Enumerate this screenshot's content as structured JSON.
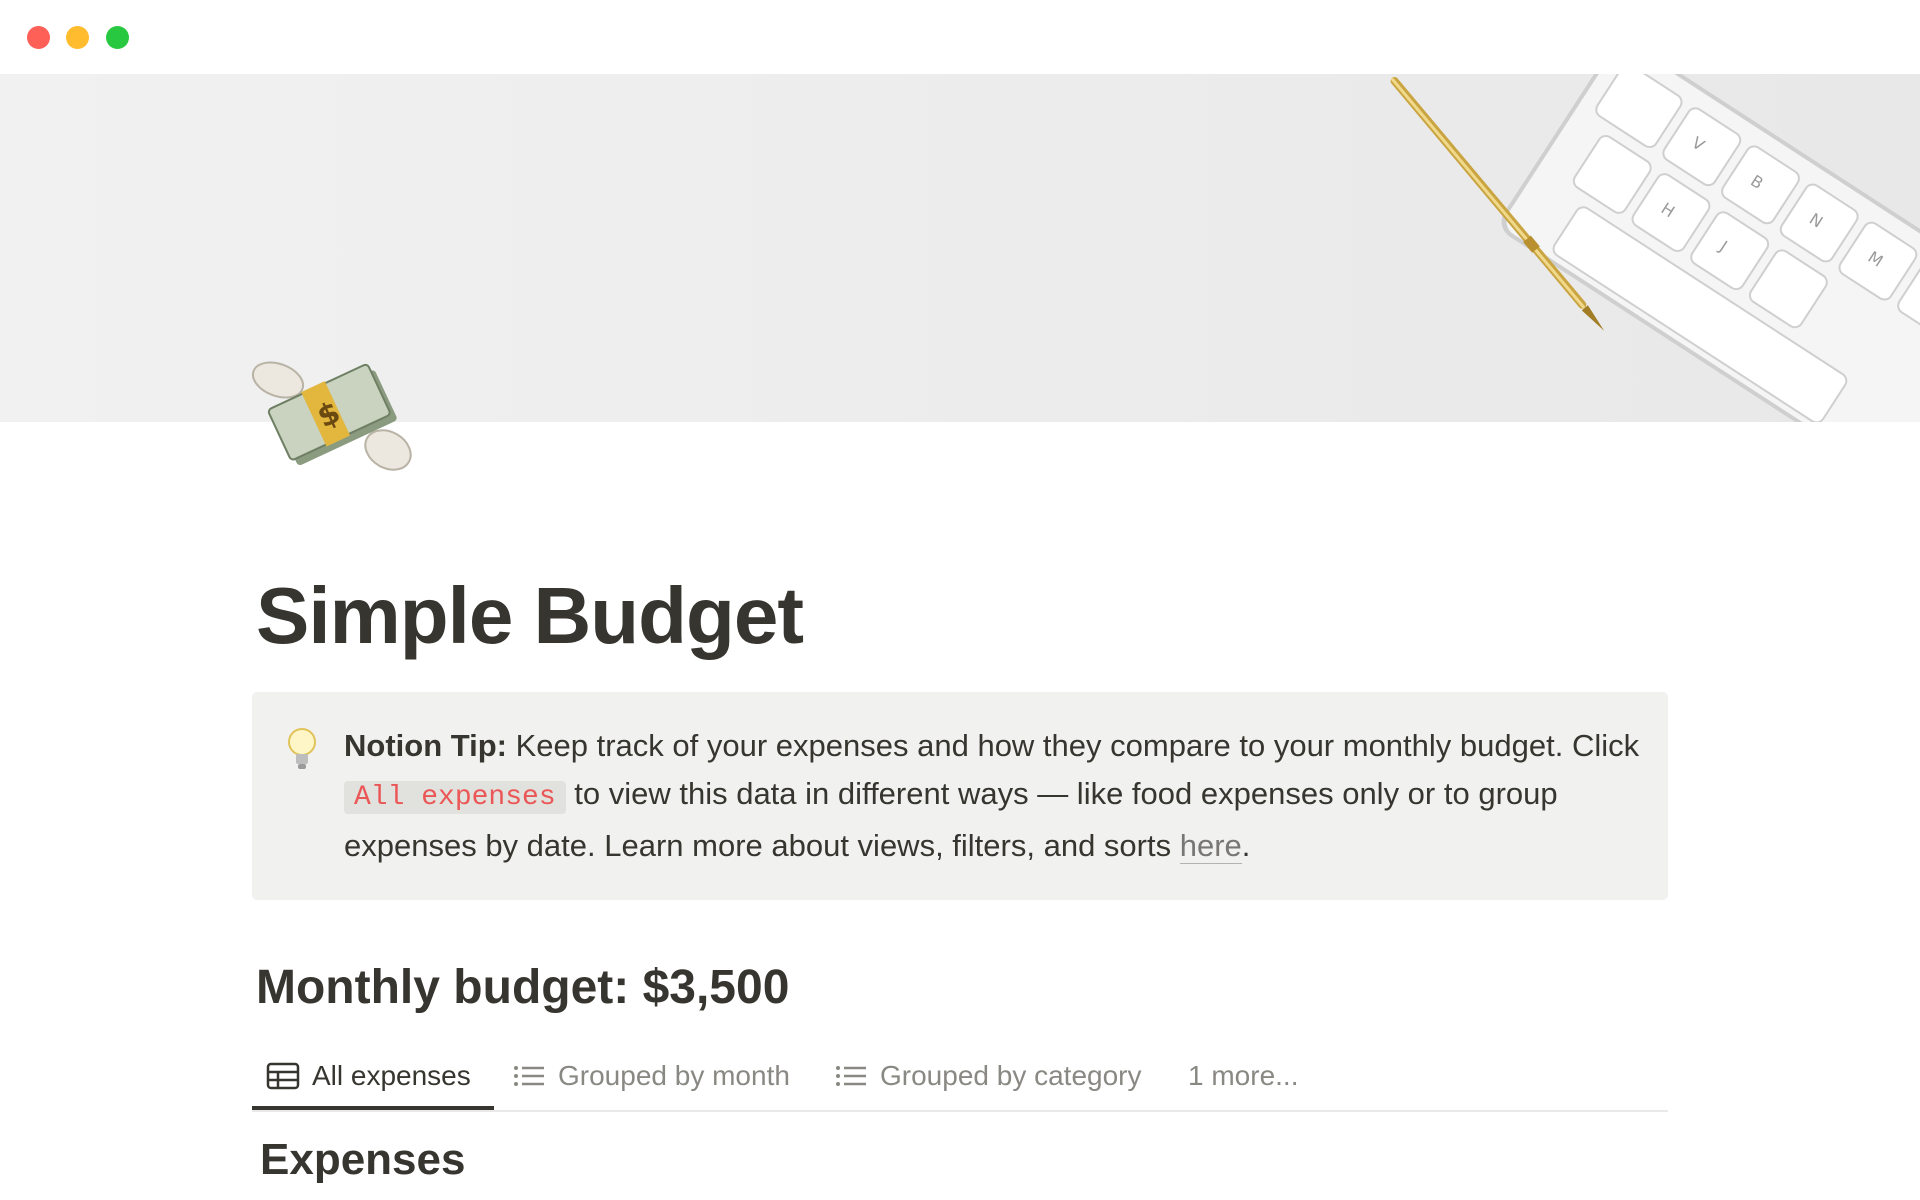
{
  "window": {
    "controls": [
      "close",
      "minimize",
      "zoom"
    ],
    "colors": {
      "close": "#fe5f57",
      "minimize": "#febc2e",
      "zoom": "#28c840"
    }
  },
  "cover": {
    "icon": "keyboard-and-gold-pen-photo"
  },
  "page": {
    "icon": "money-with-wings-icon",
    "title": "Simple Budget"
  },
  "callout": {
    "icon": "lightbulb-icon",
    "label": "Notion Tip:",
    "text_1": " Keep track of your expenses and how they compare to your monthly budget. Click ",
    "code": "All expenses",
    "text_2": " to view this data in different ways — like food expenses only or to group expenses by date. Learn more about views, filters, and sorts ",
    "link": "here",
    "text_3": "."
  },
  "budget": {
    "heading": "Monthly budget: $3,500"
  },
  "views": {
    "tabs": [
      {
        "label": "All expenses",
        "icon": "table-icon",
        "active": true
      },
      {
        "label": "Grouped by month",
        "icon": "list-icon",
        "active": false
      },
      {
        "label": "Grouped by category",
        "icon": "list-icon",
        "active": false
      },
      {
        "label": "1 more...",
        "icon": "",
        "active": false
      }
    ]
  },
  "database": {
    "title": "Expenses"
  },
  "colors": {
    "text": "#37352f",
    "muted": "#8a8883",
    "callout_bg": "#f1f1ef",
    "code_red": "#eb5757"
  }
}
